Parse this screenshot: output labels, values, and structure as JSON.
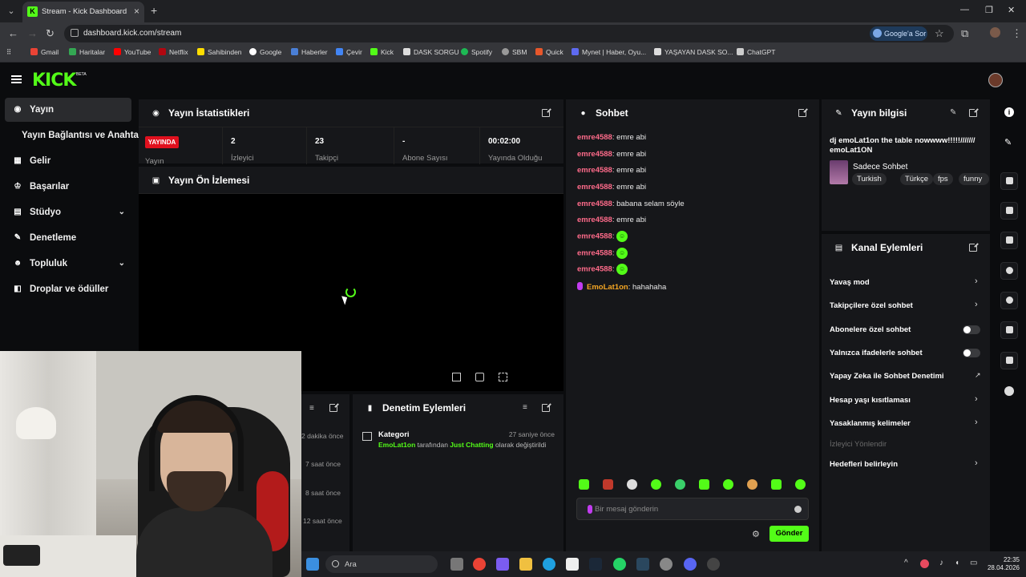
{
  "browser": {
    "tab_title": "Stream - Kick Dashboard",
    "url": "dashboard.kick.com/stream",
    "google_button": "Google'a Sor",
    "bookmarks": [
      "Gmail",
      "Haritalar",
      "YouTube",
      "Netflix",
      "Sahibinden",
      "Google",
      "Haberler",
      "Çevir",
      "Kick",
      "DASK SORGU",
      "Spotify",
      "SBM",
      "Quick",
      "Mynet | Haber, Oyu...",
      "YAŞAYAN DASK SO...",
      "ChatGPT"
    ]
  },
  "kick": {
    "logo": "KICK",
    "beta": "BETA"
  },
  "sidebar": {
    "items": [
      {
        "label": "Yayın",
        "icon": "broadcast-icon"
      },
      {
        "label": "Yayın Bağlantısı ve Anahtarı",
        "icon": ""
      },
      {
        "label": "Gelir",
        "icon": "chart-icon"
      },
      {
        "label": "Başarılar",
        "icon": "trophy-icon"
      },
      {
        "label": "Stüdyo",
        "icon": "studio-icon"
      },
      {
        "label": "Denetleme",
        "icon": "wrench-icon"
      },
      {
        "label": "Topluluk",
        "icon": "people-icon"
      },
      {
        "label": "Droplar ve ödüller",
        "icon": "gift-icon"
      }
    ]
  },
  "stats": {
    "title": "Yayın İstatistikleri",
    "live_badge": "YAYINDA",
    "live_label": "Yayın",
    "viewers_value": "2",
    "viewers_label": "İzleyici",
    "followers_value": "23",
    "followers_label": "Takipçi",
    "subs_value": "-",
    "subs_label": "Abone Sayısı",
    "uptime_value": "00:02:00",
    "uptime_label": "Yayında Olduğu"
  },
  "preview": {
    "title": "Yayın Ön İzlemesi"
  },
  "chat": {
    "title": "Sohbet",
    "messages": [
      {
        "user": "emre4588",
        "text": ": emre abi"
      },
      {
        "user": "emre4588",
        "text": ": emre abi"
      },
      {
        "user": "emre4588",
        "text": ": emre abi"
      },
      {
        "user": "emre4588",
        "text": ": emre abi"
      },
      {
        "user": "emre4588",
        "text": ": babana selam söyle"
      },
      {
        "user": "emre4588",
        "text": ": emre abi"
      },
      {
        "user": "emre4588",
        "text": ":"
      },
      {
        "user": "emre4588",
        "text": ":"
      },
      {
        "user": "emre4588",
        "text": ":"
      },
      {
        "user": "EmoLat1on",
        "text": ": hahahaha"
      }
    ],
    "placeholder": "Bir mesaj gönderin",
    "send": "Gönder"
  },
  "info": {
    "title": "Yayın bilgisi",
    "stream_title": "dj emoLat1on the table nowwww!!!!!/////// emoLat1ON",
    "category": "Sadece Sohbet",
    "tags": [
      "Turkish",
      "Türkçe",
      "fps",
      "funny"
    ]
  },
  "actions": {
    "title": "Kanal Eylemleri",
    "slow_mode": "Yavaş mod",
    "followers_chat": "Takipçilere özel sohbet",
    "subs_chat": "Abonelere özel sohbet",
    "emote_chat": "Yalnızca ifadelerle sohbet",
    "ai_mod": "Yapay Zeka ile Sohbet Denetimi",
    "age_limit": "Hesap yaşı kısıtlaması",
    "banned_words": "Yasaklanmış kelimeler",
    "redirect": "İzleyici Yönlendir",
    "goals": "Hedefleri belirleyin"
  },
  "moderation": {
    "title": "Denetim Eylemleri",
    "category_label": "Kategori",
    "time": "27 saniye önce",
    "user": "EmoLat1on",
    "mid": " tarafından ",
    "cat": "Just Chatting",
    "end": " olarak değiştirildi"
  },
  "activity": {
    "times": [
      "2 dakika önce",
      "7 saat önce",
      "8 saat önce",
      "12 saat önce"
    ]
  },
  "taskbar": {
    "search": "Ara",
    "time": "22:35",
    "date": "28.04.2026"
  },
  "colors": {
    "kick_green": "#53fc18",
    "live_red": "#e0101e",
    "username": "#ff6b8a"
  }
}
